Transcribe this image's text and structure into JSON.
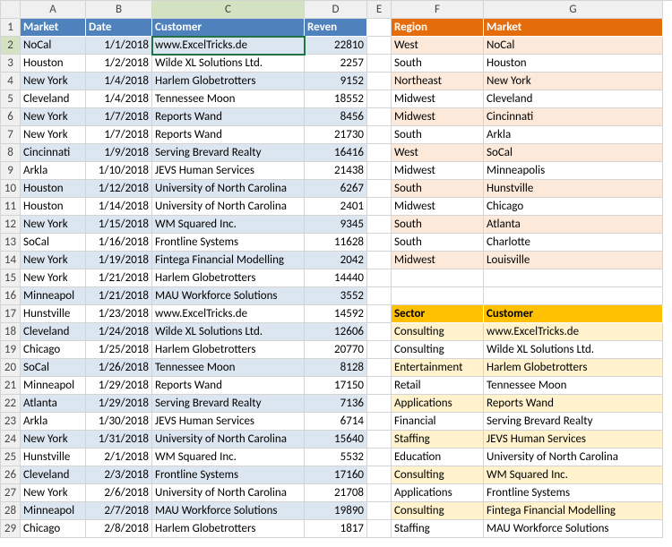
{
  "columns": [
    "A",
    "B",
    "C",
    "D",
    "E",
    "F",
    "G"
  ],
  "row_count": 29,
  "active_cell": {
    "row": 2,
    "col": "C"
  },
  "table1": {
    "headers": {
      "market": "Market",
      "date": "Date",
      "customer": "Customer",
      "reven": "Reven"
    },
    "rows": [
      {
        "market": "NoCal",
        "date": "1/1/2018",
        "customer": "www.ExcelTricks.de",
        "reven": 22810
      },
      {
        "market": "Houston",
        "date": "1/2/2018",
        "customer": "Wilde XL Solutions Ltd.",
        "reven": 2257
      },
      {
        "market": "New York",
        "date": "1/4/2018",
        "customer": "Harlem Globetrotters",
        "reven": 9152
      },
      {
        "market": "Cleveland",
        "date": "1/4/2018",
        "customer": "Tennessee Moon",
        "reven": 18552
      },
      {
        "market": "New York",
        "date": "1/7/2018",
        "customer": "Reports Wand",
        "reven": 8456
      },
      {
        "market": "New York",
        "date": "1/7/2018",
        "customer": "Reports Wand",
        "reven": 21730
      },
      {
        "market": "Cincinnati",
        "date": "1/9/2018",
        "customer": "Serving Brevard Realty",
        "reven": 16416
      },
      {
        "market": "Arkla",
        "date": "1/10/2018",
        "customer": "JEVS Human Services",
        "reven": 21438
      },
      {
        "market": "Houston",
        "date": "1/12/2018",
        "customer": "University of North Carolina",
        "reven": 6267
      },
      {
        "market": "Houston",
        "date": "1/14/2018",
        "customer": "University of North Carolina",
        "reven": 2401
      },
      {
        "market": "New York",
        "date": "1/15/2018",
        "customer": "WM Squared Inc.",
        "reven": 9345
      },
      {
        "market": "SoCal",
        "date": "1/16/2018",
        "customer": "Frontline Systems",
        "reven": 11628
      },
      {
        "market": "New York",
        "date": "1/19/2018",
        "customer": "Fintega Financial Modelling",
        "reven": 2042
      },
      {
        "market": "New York",
        "date": "1/21/2018",
        "customer": "Harlem Globetrotters",
        "reven": 14440
      },
      {
        "market": "Minneapol",
        "date": "1/21/2018",
        "customer": "MAU Workforce Solutions",
        "reven": 3552
      },
      {
        "market": "Hunstville",
        "date": "1/23/2018",
        "customer": "www.ExcelTricks.de",
        "reven": 14592
      },
      {
        "market": "Cleveland",
        "date": "1/24/2018",
        "customer": "Wilde XL Solutions Ltd.",
        "reven": 12606
      },
      {
        "market": "Chicago",
        "date": "1/25/2018",
        "customer": "Harlem Globetrotters",
        "reven": 20770
      },
      {
        "market": "SoCal",
        "date": "1/26/2018",
        "customer": "Tennessee Moon",
        "reven": 8128
      },
      {
        "market": "Minneapol",
        "date": "1/29/2018",
        "customer": "Reports Wand",
        "reven": 17150
      },
      {
        "market": "Atlanta",
        "date": "1/29/2018",
        "customer": "Serving Brevard Realty",
        "reven": 7136
      },
      {
        "market": "Arkla",
        "date": "1/30/2018",
        "customer": "JEVS Human Services",
        "reven": 6714
      },
      {
        "market": "New York",
        "date": "1/31/2018",
        "customer": "University of North Carolina",
        "reven": 15640
      },
      {
        "market": "Hunstville",
        "date": "2/1/2018",
        "customer": "WM Squared Inc.",
        "reven": 5532
      },
      {
        "market": "Cleveland",
        "date": "2/3/2018",
        "customer": "Frontline Systems",
        "reven": 17160
      },
      {
        "market": "New York",
        "date": "2/6/2018",
        "customer": "University of North Carolina",
        "reven": 21708
      },
      {
        "market": "Minneapol",
        "date": "2/7/2018",
        "customer": "MAU Workforce Solutions",
        "reven": 19890
      },
      {
        "market": "Chicago",
        "date": "2/8/2018",
        "customer": "Harlem Globetrotters",
        "reven": 1817
      }
    ]
  },
  "table2": {
    "headers": {
      "region": "Region",
      "market": "Market"
    },
    "rows": [
      {
        "region": "West",
        "market": "NoCal"
      },
      {
        "region": "South",
        "market": "Houston"
      },
      {
        "region": "Northeast",
        "market": "New York"
      },
      {
        "region": "Midwest",
        "market": "Cleveland"
      },
      {
        "region": "Midwest",
        "market": "Cincinnati"
      },
      {
        "region": "South",
        "market": "Arkla"
      },
      {
        "region": "West",
        "market": "SoCal"
      },
      {
        "region": "Midwest",
        "market": "Minneapolis"
      },
      {
        "region": "South",
        "market": "Hunstville"
      },
      {
        "region": "Midwest",
        "market": "Chicago"
      },
      {
        "region": "South",
        "market": "Atlanta"
      },
      {
        "region": "South",
        "market": "Charlotte"
      },
      {
        "region": "Midwest",
        "market": "Louisville"
      }
    ]
  },
  "table3": {
    "headers": {
      "sector": "Sector",
      "customer": "Customer"
    },
    "rows": [
      {
        "sector": "Consulting",
        "customer": "www.ExcelTricks.de"
      },
      {
        "sector": "Consulting",
        "customer": "Wilde XL Solutions Ltd."
      },
      {
        "sector": "Entertainment",
        "customer": "Harlem Globetrotters"
      },
      {
        "sector": "Retail",
        "customer": "Tennessee Moon"
      },
      {
        "sector": "Applications",
        "customer": "Reports Wand"
      },
      {
        "sector": "Financial",
        "customer": "Serving Brevard Realty"
      },
      {
        "sector": "Staffing",
        "customer": "JEVS Human Services"
      },
      {
        "sector": "Education",
        "customer": "University of North Carolina"
      },
      {
        "sector": "Consulting",
        "customer": "WM Squared Inc."
      },
      {
        "sector": "Applications",
        "customer": "Frontline Systems"
      },
      {
        "sector": "Consulting",
        "customer": "Fintega Financial Modelling"
      },
      {
        "sector": "Staffing",
        "customer": "MAU Workforce Solutions"
      }
    ]
  }
}
